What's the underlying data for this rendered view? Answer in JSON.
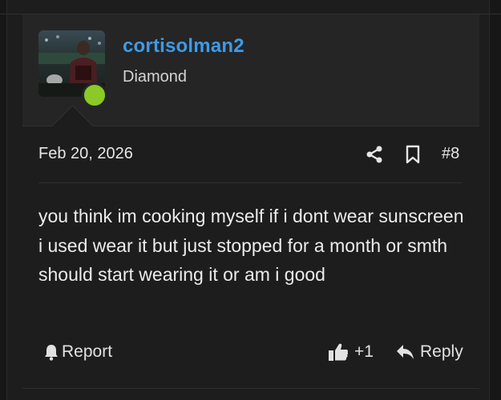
{
  "post": {
    "username": "cortisolman2",
    "rank": "Diamond",
    "date": "Feb 20, 2026",
    "post_number": "#8",
    "body": "you think im cooking myself if i dont wear sunscreen i used wear it but just stopped for a month or smth should start wearing it or am i good",
    "online": true
  },
  "actions": {
    "report_label": "Report",
    "like_count": "+1",
    "reply_label": "Reply"
  },
  "colors": {
    "username": "#3d9be9",
    "online_dot": "#8ac926",
    "background": "#1d1d1d",
    "user_block": "#252525"
  },
  "icons": [
    "share-icon",
    "bookmark-icon",
    "bell-icon",
    "thumbs-up-icon",
    "reply-arrow-icon"
  ]
}
